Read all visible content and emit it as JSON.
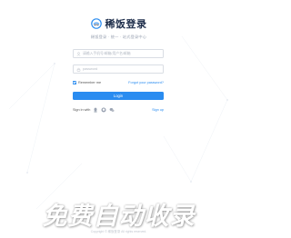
{
  "header": {
    "title": "稀饭登录",
    "subtitle": "稀饭登录 · 统一 · 站式登录中心"
  },
  "form": {
    "username_placeholder": "请输入手机号/邮箱/用户名/邮箱",
    "password_placeholder": "password",
    "remember_label": "Remember me",
    "remember_checked": true,
    "forgot_label": "Forgot your password?",
    "login_label": "Login"
  },
  "social": {
    "signin_label": "Sign in with",
    "icons": [
      "qq-icon",
      "github-icon",
      "wechat-icon"
    ],
    "signup_label": "Sign up"
  },
  "banner": {
    "text": "免费自动收录"
  },
  "footer": {
    "text": "Copyright © 稀饭登录 All rights reserved."
  },
  "colors": {
    "accent": "#2a8cf0",
    "title": "#1d2d4a",
    "muted": "#9aa3b2",
    "border": "#d9dde4"
  }
}
